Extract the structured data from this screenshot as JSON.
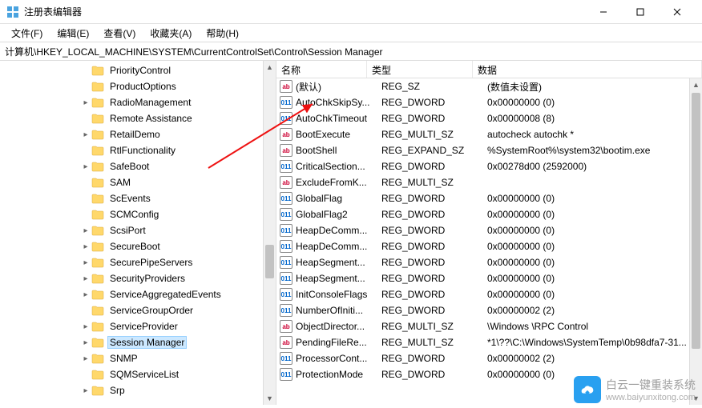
{
  "window": {
    "title": "注册表编辑器",
    "min_tip": "最小化",
    "max_tip": "最大化",
    "close_tip": "关闭"
  },
  "menu": [
    "文件(F)",
    "编辑(E)",
    "查看(V)",
    "收藏夹(A)",
    "帮助(H)"
  ],
  "path": "计算机\\HKEY_LOCAL_MACHINE\\SYSTEM\\CurrentControlSet\\Control\\Session Manager",
  "tree": [
    {
      "label": "PriorityControl",
      "indent": 92,
      "arrow": ""
    },
    {
      "label": "ProductOptions",
      "indent": 92,
      "arrow": ""
    },
    {
      "label": "RadioManagement",
      "indent": 92,
      "arrow": "▸"
    },
    {
      "label": "Remote Assistance",
      "indent": 92,
      "arrow": ""
    },
    {
      "label": "RetailDemo",
      "indent": 92,
      "arrow": "▸"
    },
    {
      "label": "RtlFunctionality",
      "indent": 92,
      "arrow": ""
    },
    {
      "label": "SafeBoot",
      "indent": 92,
      "arrow": "▸"
    },
    {
      "label": "SAM",
      "indent": 92,
      "arrow": ""
    },
    {
      "label": "ScEvents",
      "indent": 92,
      "arrow": ""
    },
    {
      "label": "SCMConfig",
      "indent": 92,
      "arrow": ""
    },
    {
      "label": "ScsiPort",
      "indent": 92,
      "arrow": "▸"
    },
    {
      "label": "SecureBoot",
      "indent": 92,
      "arrow": "▸"
    },
    {
      "label": "SecurePipeServers",
      "indent": 92,
      "arrow": "▸"
    },
    {
      "label": "SecurityProviders",
      "indent": 92,
      "arrow": "▸"
    },
    {
      "label": "ServiceAggregatedEvents",
      "indent": 92,
      "arrow": "▸"
    },
    {
      "label": "ServiceGroupOrder",
      "indent": 92,
      "arrow": ""
    },
    {
      "label": "ServiceProvider",
      "indent": 92,
      "arrow": "▸"
    },
    {
      "label": "Session Manager",
      "indent": 92,
      "arrow": "▸",
      "selected": true
    },
    {
      "label": "SNMP",
      "indent": 92,
      "arrow": "▸"
    },
    {
      "label": "SQMServiceList",
      "indent": 92,
      "arrow": ""
    },
    {
      "label": "Srp",
      "indent": 92,
      "arrow": "▸"
    }
  ],
  "columns": {
    "name": "名称",
    "type": "类型",
    "data": "数据"
  },
  "values": [
    {
      "icon": "str",
      "name": "(默认)",
      "type": "REG_SZ",
      "data": "(数值未设置)"
    },
    {
      "icon": "bin",
      "name": "AutoChkSkipSy...",
      "type": "REG_DWORD",
      "data": "0x00000000 (0)"
    },
    {
      "icon": "bin",
      "name": "AutoChkTimeout",
      "type": "REG_DWORD",
      "data": "0x00000008 (8)"
    },
    {
      "icon": "str",
      "name": "BootExecute",
      "type": "REG_MULTI_SZ",
      "data": "autocheck autochk *"
    },
    {
      "icon": "str",
      "name": "BootShell",
      "type": "REG_EXPAND_SZ",
      "data": "%SystemRoot%\\system32\\bootim.exe"
    },
    {
      "icon": "bin",
      "name": "CriticalSection...",
      "type": "REG_DWORD",
      "data": "0x00278d00 (2592000)"
    },
    {
      "icon": "str",
      "name": "ExcludeFromK...",
      "type": "REG_MULTI_SZ",
      "data": ""
    },
    {
      "icon": "bin",
      "name": "GlobalFlag",
      "type": "REG_DWORD",
      "data": "0x00000000 (0)"
    },
    {
      "icon": "bin",
      "name": "GlobalFlag2",
      "type": "REG_DWORD",
      "data": "0x00000000 (0)"
    },
    {
      "icon": "bin",
      "name": "HeapDeComm...",
      "type": "REG_DWORD",
      "data": "0x00000000 (0)"
    },
    {
      "icon": "bin",
      "name": "HeapDeComm...",
      "type": "REG_DWORD",
      "data": "0x00000000 (0)"
    },
    {
      "icon": "bin",
      "name": "HeapSegment...",
      "type": "REG_DWORD",
      "data": "0x00000000 (0)"
    },
    {
      "icon": "bin",
      "name": "HeapSegment...",
      "type": "REG_DWORD",
      "data": "0x00000000 (0)"
    },
    {
      "icon": "bin",
      "name": "InitConsoleFlags",
      "type": "REG_DWORD",
      "data": "0x00000000 (0)"
    },
    {
      "icon": "bin",
      "name": "NumberOfIniti...",
      "type": "REG_DWORD",
      "data": "0x00000002 (2)"
    },
    {
      "icon": "str",
      "name": "ObjectDirector...",
      "type": "REG_MULTI_SZ",
      "data": "\\Windows \\RPC Control"
    },
    {
      "icon": "str",
      "name": "PendingFileRe...",
      "type": "REG_MULTI_SZ",
      "data": "*1\\??\\C:\\Windows\\SystemTemp\\0b98dfa7-31..."
    },
    {
      "icon": "bin",
      "name": "ProcessorCont...",
      "type": "REG_DWORD",
      "data": "0x00000002 (2)"
    },
    {
      "icon": "bin",
      "name": "ProtectionMode",
      "type": "REG_DWORD",
      "data": "0x00000000 (0)"
    }
  ],
  "watermark": {
    "brand": "白云一键重装系统",
    "url": "www.baiyunxitong.com"
  }
}
